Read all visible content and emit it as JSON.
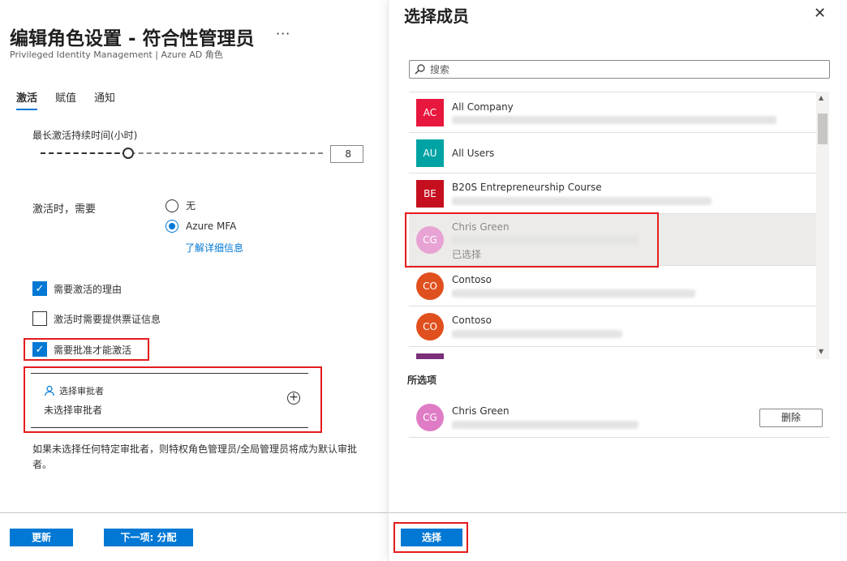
{
  "left": {
    "title": "编辑角色设置 - 符合性管理员",
    "more": "···",
    "subtitle": "Privileged Identity Management | Azure AD 角色",
    "tabs": [
      {
        "label": "激活",
        "active": true
      },
      {
        "label": "赋值",
        "active": false
      },
      {
        "label": "通知",
        "active": false
      }
    ],
    "duration_label": "最长激活持续时间(小时)",
    "duration_value": "8",
    "duration_fraction": 0.31,
    "activation_label": "激活时，需要",
    "radio": {
      "none": "无",
      "mfa": "Azure MFA",
      "selected": "mfa"
    },
    "learn_more": "了解详细信息",
    "checkboxes": [
      {
        "label": "需要激活的理由",
        "checked": true
      },
      {
        "label": "激活时需要提供票证信息",
        "checked": false
      },
      {
        "label": "需要批准才能激活",
        "checked": true
      }
    ],
    "approver": {
      "label": "选择审批者",
      "value": "未选择审批者"
    },
    "note": "如果未选择任何特定审批者，则特权角色管理员/全局管理员将成为默认审批者。",
    "buttons": {
      "update": "更新",
      "next": "下一项: 分配"
    }
  },
  "right": {
    "title": "选择成员",
    "search_placeholder": "搜索",
    "members": [
      {
        "initials": "AC",
        "name": "All Company",
        "color": "#e8173d",
        "shape": "square",
        "has_detail": true
      },
      {
        "initials": "AU",
        "name": "All Users",
        "color": "#00a3a3",
        "shape": "square",
        "has_detail": false
      },
      {
        "initials": "BE",
        "name": "B20S Entrepreneurship Course",
        "color": "#c50f1f",
        "shape": "square",
        "has_detail": true
      },
      {
        "initials": "CG",
        "name": "Chris Green",
        "color": "#e8a3d4",
        "shape": "circle",
        "has_detail": true,
        "selected": true,
        "selected_text": "已选择"
      },
      {
        "initials": "CO",
        "name": "Contoso",
        "color": "#e0501e",
        "shape": "circle",
        "has_detail": true
      },
      {
        "initials": "CO",
        "name": "Contoso",
        "color": "#e0501e",
        "shape": "circle",
        "has_detail": true
      },
      {
        "initials": "",
        "name": "",
        "color": "#7a2f78",
        "shape": "square",
        "has_detail": false
      }
    ],
    "selected_header": "所选项",
    "selected_item": {
      "initials": "CG",
      "name": "Chris Green",
      "color": "#e07cc6"
    },
    "remove_button": "删除",
    "select_button": "选择",
    "close_icon": "close-icon"
  },
  "colors": {
    "accent": "#0078d4",
    "highlight": "#e31c1c"
  }
}
